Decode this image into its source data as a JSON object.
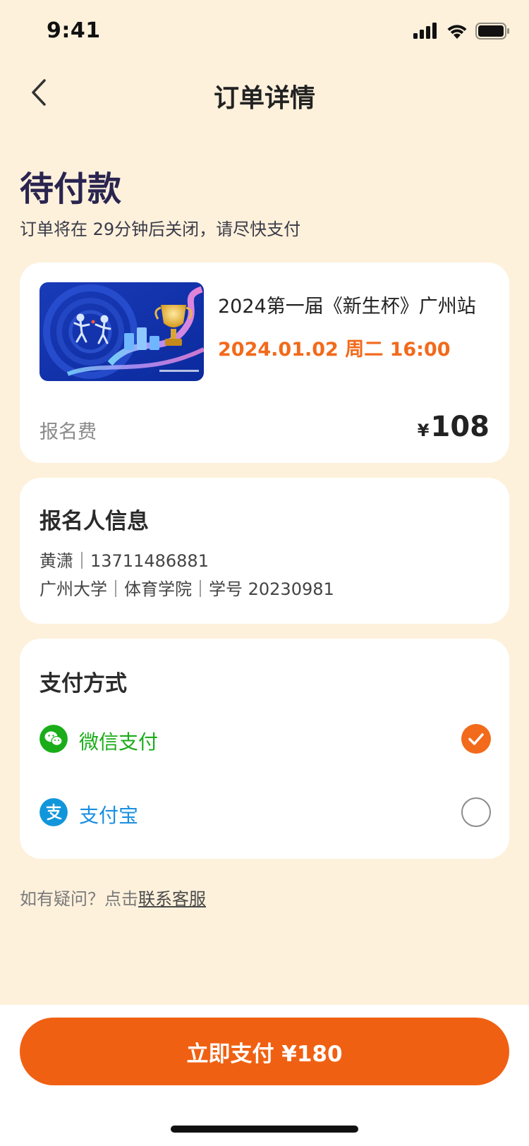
{
  "status_bar": {
    "time": "9:41",
    "icons": [
      "signal-icon",
      "wifi-icon",
      "battery-icon"
    ]
  },
  "nav": {
    "title": "订单详情",
    "back_icon": "chevron-left-icon"
  },
  "order": {
    "status": "待付款",
    "hint": "订单将在 29分钟后关闭，请尽快支付"
  },
  "event": {
    "name": "2024第一届《新生杯》广州站",
    "time": "2024.01.02 周二 16:00",
    "fee_label": "报名费",
    "fee_currency": "¥",
    "fee_value": "108"
  },
  "registrant": {
    "title": "报名人信息",
    "line1": "黄潇｜13711486881",
    "line2": "广州大学｜体育学院｜学号 20230981"
  },
  "payment": {
    "title": "支付方式",
    "options": [
      {
        "label": "微信支付",
        "icon": "wechat-pay-icon",
        "color": "#1AAD19",
        "selected": true
      },
      {
        "label": "支付宝",
        "icon": "alipay-icon",
        "color": "#1677FF",
        "selected": false
      }
    ]
  },
  "help": {
    "prefix": "如有疑问？点击",
    "link": "联系客服"
  },
  "footer": {
    "pay_button": "立即支付 ¥180"
  },
  "colors": {
    "background": "#FDF1DC",
    "accent": "#F06012",
    "status_title": "#2A2450",
    "wechat": "#1AAD19",
    "alipay": "#1677FF"
  }
}
